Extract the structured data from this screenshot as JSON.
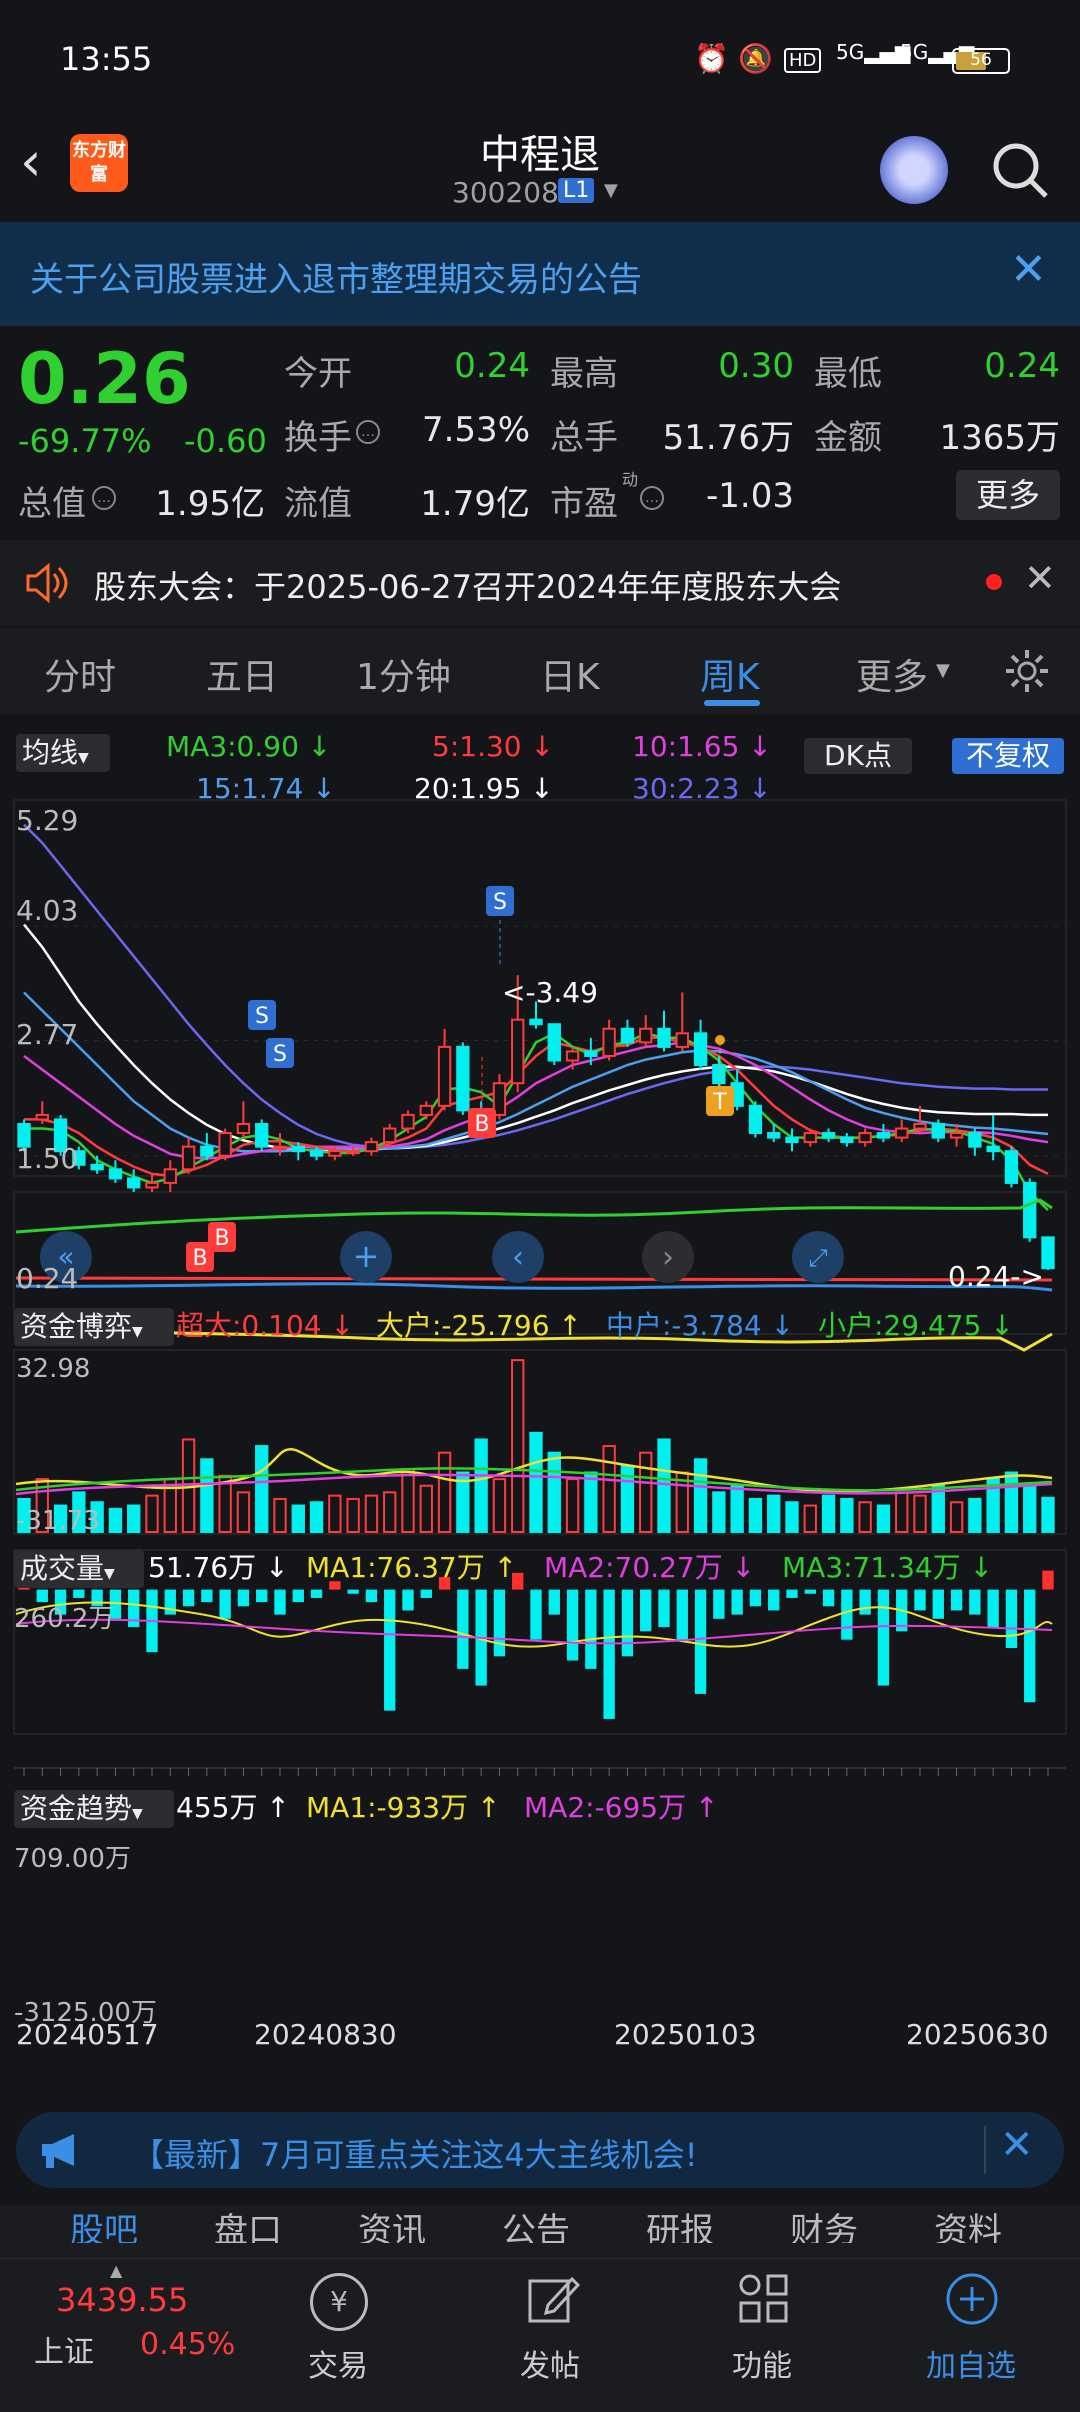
{
  "status": {
    "time": "13:55",
    "battery": "56"
  },
  "nav": {
    "logo": "东方财富",
    "title": "中程退",
    "code": "300208",
    "level": "L1"
  },
  "notice": {
    "text": "关于公司股票进入退市整理期交易的公告"
  },
  "quote": {
    "price": "0.26",
    "pct": "-69.77%",
    "chg": "-0.60",
    "open_lbl": "今开",
    "open": "0.24",
    "high_lbl": "最高",
    "high": "0.30",
    "low_lbl": "最低",
    "low": "0.24",
    "turn_lbl": "换手",
    "turn": "7.53%",
    "vol_lbl": "总手",
    "vol": "51.76万",
    "amt_lbl": "金额",
    "amt": "1365万",
    "mcap_lbl": "总值",
    "mcap": "1.95亿",
    "float_lbl": "流值",
    "float": "1.79亿",
    "pe_lbl": "市盈",
    "pe_sup": "动",
    "pe": "-1.03",
    "more": "更多"
  },
  "meeting": {
    "text": "股东大会：于2025-06-27召开2024年年度股东大会"
  },
  "tabs": [
    "分时",
    "五日",
    "1分钟",
    "日K",
    "周K",
    "更多"
  ],
  "ma": {
    "sel": "均线",
    "ma3": "MA3:0.90",
    "ma5": "5:1.30",
    "ma10": "10:1.65",
    "ma15": "15:1.74",
    "ma20": "20:1.95",
    "ma30": "30:2.23",
    "dk": "DK点",
    "fq": "不复权"
  },
  "price_axis": {
    "top": "5.29",
    "y2": "4.03",
    "y3": "2.77",
    "y4": "1.50",
    "bottom": "0.24",
    "maxmark": "<-3.49",
    "minmark": "0.24->"
  },
  "fund": {
    "sel": "资金博弈",
    "super": "超大:0.104",
    "big": "大户:-25.796",
    "mid": "中户:-3.784",
    "small": "小户:29.475",
    "top": "32.98",
    "bottom": "-31.73"
  },
  "volume": {
    "sel": "成交量",
    "cur": "51.76万",
    "ma1": "MA1:76.37万",
    "ma2": "MA2:70.27万",
    "ma3": "MA3:71.34万",
    "top": "260.2万"
  },
  "trend": {
    "sel": "资金趋势",
    "cur": "455万",
    "ma1": "MA1:-933万",
    "ma2": "MA2:-695万",
    "top": "709.00万",
    "bottom": "-3125.00万"
  },
  "dates": [
    "20240517",
    "20240830",
    "20250103",
    "20250630"
  ],
  "promo": {
    "text": "【最新】7月可重点关注这4大主线机会!"
  },
  "bottom_tabs": [
    "股吧",
    "盘口",
    "资讯",
    "公告",
    "研报",
    "财务",
    "资料"
  ],
  "index": {
    "price": "3439.55",
    "name": "上证",
    "pct": "0.45%"
  },
  "bottom_nav": [
    "交易",
    "发帖",
    "功能",
    "加自选"
  ],
  "colors": {
    "up": "#ff3b3b",
    "down": "#00f0f0",
    "green": "#2fd02f",
    "accent": "#3a8ee6"
  },
  "chart_data": {
    "type": "candlestick",
    "period": "weekly",
    "candles": [
      [
        1.85,
        1.9,
        1.6,
        1.55
      ],
      [
        1.9,
        2.1,
        1.95,
        1.85
      ],
      [
        1.9,
        1.95,
        1.55,
        1.5
      ],
      [
        1.55,
        1.6,
        1.4,
        1.35
      ],
      [
        1.4,
        1.5,
        1.35,
        1.3
      ],
      [
        1.35,
        1.45,
        1.25,
        1.2
      ],
      [
        1.25,
        1.35,
        1.15,
        1.1
      ],
      [
        1.15,
        1.3,
        1.2,
        1.1
      ],
      [
        1.2,
        1.45,
        1.35,
        1.1
      ],
      [
        1.35,
        1.7,
        1.6,
        1.3
      ],
      [
        1.6,
        1.75,
        1.5,
        1.45
      ],
      [
        1.5,
        1.8,
        1.75,
        1.45
      ],
      [
        1.75,
        2.1,
        1.85,
        1.7
      ],
      [
        1.85,
        1.9,
        1.6,
        1.55
      ],
      [
        1.6,
        1.75,
        1.6,
        1.5
      ],
      [
        1.6,
        1.65,
        1.55,
        1.45
      ],
      [
        1.55,
        1.6,
        1.5,
        1.45
      ],
      [
        1.5,
        1.6,
        1.55,
        1.45
      ],
      [
        1.55,
        1.6,
        1.55,
        1.5
      ],
      [
        1.55,
        1.7,
        1.65,
        1.5
      ],
      [
        1.65,
        1.85,
        1.8,
        1.6
      ],
      [
        1.8,
        2.0,
        1.95,
        1.75
      ],
      [
        1.95,
        2.1,
        2.05,
        1.9
      ],
      [
        2.05,
        2.9,
        2.7,
        2.0
      ],
      [
        2.7,
        2.75,
        2.0,
        1.95
      ],
      [
        2.0,
        2.1,
        1.9,
        1.85
      ],
      [
        1.95,
        2.4,
        2.3,
        1.9
      ],
      [
        2.3,
        3.49,
        3.0,
        2.2
      ],
      [
        3.0,
        3.2,
        2.95,
        2.9
      ],
      [
        2.95,
        2.95,
        2.55,
        2.5
      ],
      [
        2.55,
        2.7,
        2.65,
        2.45
      ],
      [
        2.65,
        2.8,
        2.6,
        2.5
      ],
      [
        2.6,
        3.0,
        2.9,
        2.55
      ],
      [
        2.9,
        3.0,
        2.75,
        2.7
      ],
      [
        2.75,
        3.05,
        2.9,
        2.7
      ],
      [
        2.9,
        3.1,
        2.7,
        2.65
      ],
      [
        2.7,
        3.3,
        2.85,
        2.65
      ],
      [
        2.85,
        3.0,
        2.5,
        2.45
      ],
      [
        2.5,
        2.6,
        2.3,
        2.25
      ],
      [
        2.3,
        2.45,
        2.05,
        2.0
      ],
      [
        2.05,
        2.1,
        1.75,
        1.7
      ],
      [
        1.75,
        1.85,
        1.7,
        1.65
      ],
      [
        1.7,
        1.8,
        1.65,
        1.55
      ],
      [
        1.65,
        1.8,
        1.75,
        1.6
      ],
      [
        1.75,
        1.8,
        1.7,
        1.65
      ],
      [
        1.7,
        1.75,
        1.65,
        1.6
      ],
      [
        1.65,
        1.8,
        1.75,
        1.6
      ],
      [
        1.75,
        1.85,
        1.7,
        1.65
      ],
      [
        1.7,
        1.9,
        1.8,
        1.65
      ],
      [
        1.8,
        2.05,
        1.85,
        1.75
      ],
      [
        1.85,
        1.9,
        1.7,
        1.65
      ],
      [
        1.7,
        1.85,
        1.75,
        1.6
      ],
      [
        1.75,
        1.8,
        1.6,
        1.5
      ],
      [
        1.6,
        1.95,
        1.55,
        1.45
      ],
      [
        1.55,
        1.6,
        1.2,
        1.15
      ],
      [
        1.2,
        1.25,
        0.6,
        0.55
      ],
      [
        0.6,
        0.3,
        0.26,
        0.24
      ]
    ],
    "ma3": [
      1.8,
      1.8,
      1.78,
      1.65,
      1.45,
      1.35,
      1.27,
      1.2,
      1.25,
      1.37,
      1.48,
      1.6,
      1.7,
      1.73,
      1.68,
      1.58,
      1.55,
      1.53,
      1.53,
      1.58,
      1.67,
      1.8,
      1.93,
      2.23,
      2.25,
      2.2,
      2.05,
      2.4,
      2.75,
      2.85,
      2.7,
      2.62,
      2.72,
      2.75,
      2.85,
      2.8,
      2.8,
      2.7,
      2.55,
      2.3,
      2.05,
      1.85,
      1.7,
      1.7,
      1.7,
      1.7,
      1.7,
      1.72,
      1.75,
      1.8,
      1.78,
      1.77,
      1.7,
      1.63,
      1.45,
      1.1,
      0.9
    ],
    "ma5": [
      1.9,
      1.9,
      1.85,
      1.75,
      1.6,
      1.48,
      1.38,
      1.3,
      1.28,
      1.33,
      1.4,
      1.5,
      1.62,
      1.66,
      1.66,
      1.63,
      1.6,
      1.56,
      1.55,
      1.57,
      1.63,
      1.7,
      1.8,
      2.05,
      2.1,
      2.15,
      2.2,
      2.4,
      2.6,
      2.75,
      2.7,
      2.65,
      2.7,
      2.72,
      2.8,
      2.8,
      2.75,
      2.7,
      2.6,
      2.45,
      2.25,
      2.05,
      1.9,
      1.78,
      1.72,
      1.7,
      1.7,
      1.72,
      1.73,
      1.78,
      1.8,
      1.78,
      1.75,
      1.7,
      1.6,
      1.4,
      1.3
    ],
    "ma10": [
      2.6,
      2.45,
      2.3,
      2.15,
      2.0,
      1.85,
      1.72,
      1.62,
      1.52,
      1.48,
      1.47,
      1.48,
      1.52,
      1.55,
      1.58,
      1.6,
      1.6,
      1.6,
      1.6,
      1.6,
      1.6,
      1.63,
      1.68,
      1.78,
      1.86,
      1.93,
      2.02,
      2.15,
      2.3,
      2.4,
      2.5,
      2.55,
      2.6,
      2.65,
      2.7,
      2.72,
      2.75,
      2.72,
      2.68,
      2.6,
      2.5,
      2.38,
      2.25,
      2.12,
      2.0,
      1.9,
      1.82,
      1.78,
      1.76,
      1.75,
      1.76,
      1.76,
      1.76,
      1.75,
      1.72,
      1.68,
      1.65
    ],
    "ma15": [
      3.3,
      3.1,
      2.9,
      2.7,
      2.5,
      2.3,
      2.1,
      1.95,
      1.8,
      1.7,
      1.62,
      1.58,
      1.55,
      1.55,
      1.55,
      1.56,
      1.57,
      1.58,
      1.58,
      1.58,
      1.58,
      1.6,
      1.62,
      1.68,
      1.74,
      1.8,
      1.87,
      1.96,
      2.06,
      2.16,
      2.26,
      2.34,
      2.42,
      2.5,
      2.56,
      2.6,
      2.64,
      2.66,
      2.65,
      2.62,
      2.57,
      2.5,
      2.42,
      2.32,
      2.22,
      2.12,
      2.03,
      1.97,
      1.92,
      1.88,
      1.85,
      1.83,
      1.81,
      1.8,
      1.78,
      1.76,
      1.74
    ],
    "ma20": [
      4.05,
      3.8,
      3.5,
      3.2,
      2.95,
      2.72,
      2.5,
      2.3,
      2.12,
      1.97,
      1.84,
      1.74,
      1.67,
      1.62,
      1.59,
      1.57,
      1.56,
      1.56,
      1.56,
      1.57,
      1.58,
      1.59,
      1.61,
      1.65,
      1.7,
      1.75,
      1.8,
      1.86,
      1.93,
      2.0,
      2.08,
      2.15,
      2.22,
      2.28,
      2.34,
      2.39,
      2.43,
      2.46,
      2.48,
      2.48,
      2.46,
      2.43,
      2.38,
      2.32,
      2.25,
      2.18,
      2.12,
      2.07,
      2.03,
      2.0,
      1.98,
      1.97,
      1.96,
      1.96,
      1.96,
      1.95,
      1.95
    ],
    "ma30": [
      5.15,
      4.95,
      4.7,
      4.45,
      4.2,
      3.95,
      3.7,
      3.45,
      3.2,
      2.95,
      2.72,
      2.5,
      2.3,
      2.12,
      1.97,
      1.84,
      1.74,
      1.67,
      1.62,
      1.6,
      1.59,
      1.59,
      1.6,
      1.62,
      1.65,
      1.69,
      1.73,
      1.78,
      1.84,
      1.9,
      1.97,
      2.04,
      2.11,
      2.18,
      2.24,
      2.3,
      2.35,
      2.4,
      2.43,
      2.46,
      2.48,
      2.48,
      2.47,
      2.45,
      2.42,
      2.39,
      2.36,
      2.33,
      2.3,
      2.28,
      2.26,
      2.25,
      2.24,
      2.24,
      2.23,
      2.23,
      2.23
    ],
    "volume": [
      50,
      80,
      40,
      60,
      45,
      35,
      40,
      55,
      80,
      140,
      110,
      85,
      60,
      130,
      50,
      40,
      45,
      55,
      50,
      55,
      60,
      95,
      70,
      120,
      90,
      140,
      80,
      260,
      150,
      120,
      80,
      90,
      130,
      100,
      120,
      140,
      90,
      110,
      60,
      70,
      50,
      55,
      45,
      40,
      55,
      50,
      45,
      40,
      60,
      55,
      70,
      45,
      50,
      80,
      90,
      70,
      51.76
    ],
    "trend": [
      500,
      -300,
      -600,
      -200,
      -400,
      -700,
      -900,
      -1500,
      -600,
      -400,
      -300,
      -700,
      -400,
      -300,
      -600,
      -300,
      -200,
      200,
      -100,
      -300,
      -2900,
      -500,
      -200,
      300,
      -1900,
      -2300,
      -1600,
      400,
      -1200,
      -600,
      -1700,
      -1900,
      -3100,
      -1600,
      -1000,
      -900,
      -1200,
      -2500,
      -700,
      -600,
      -400,
      -500,
      -200,
      -100,
      -400,
      -1200,
      -600,
      -2300,
      -1000,
      -500,
      -700,
      -500,
      -600,
      -900,
      -1400,
      -2700,
      455
    ]
  }
}
